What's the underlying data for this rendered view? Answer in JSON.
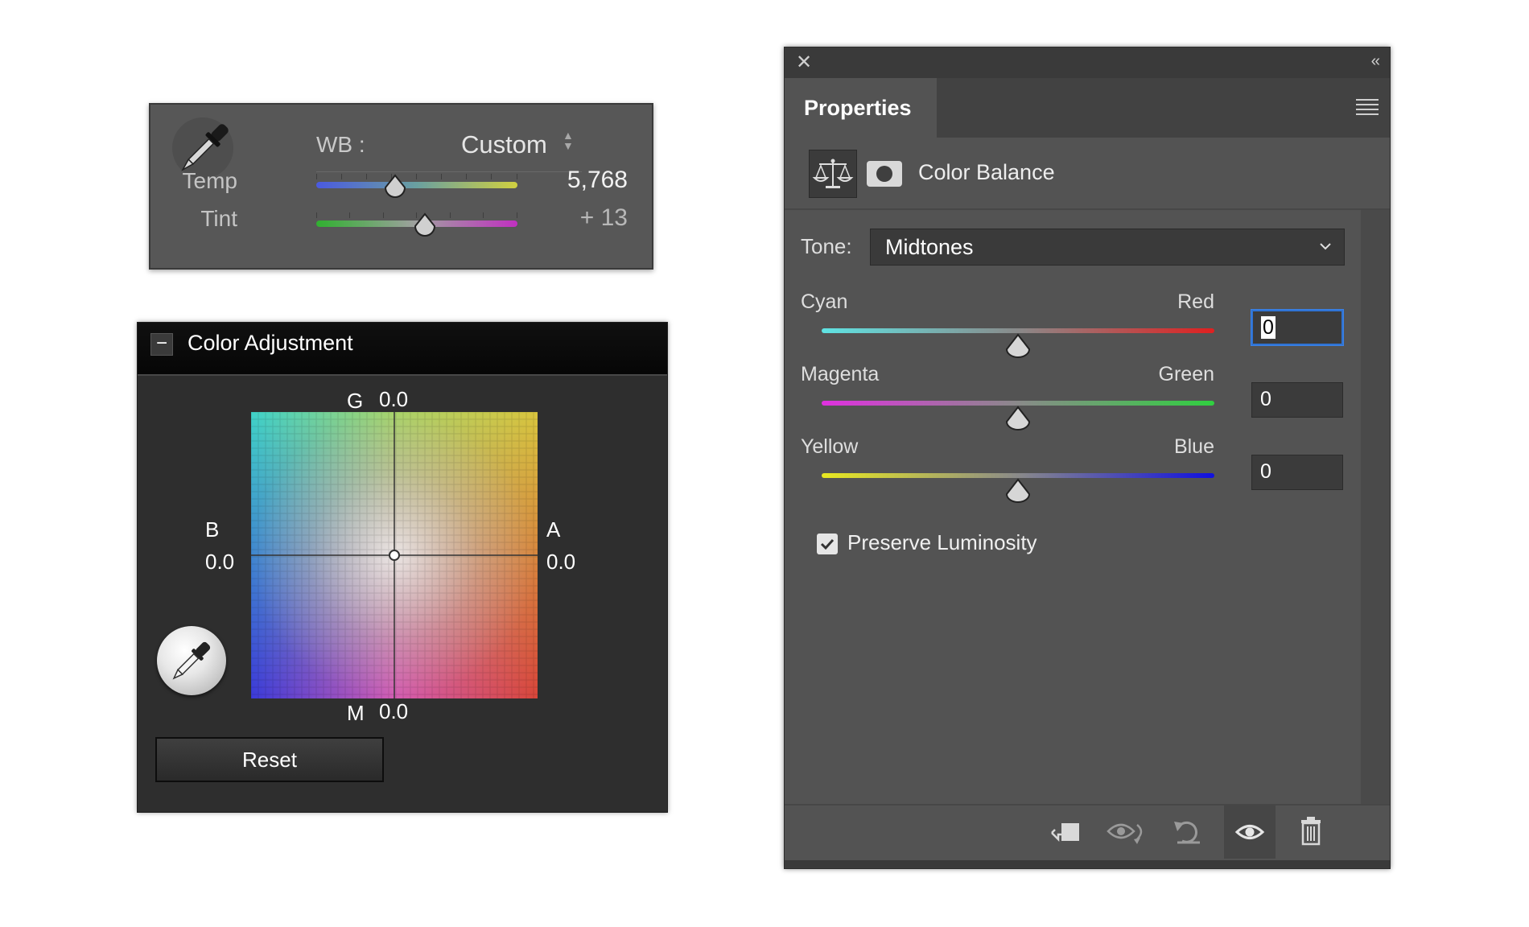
{
  "wb_panel": {
    "wb_label": "WB :",
    "wb_value": "Custom",
    "temp_label": "Temp",
    "temp_value": "5,768",
    "temp_position": 0.39,
    "tint_label": "Tint",
    "tint_value": "+ 13",
    "tint_position": 0.54,
    "icons": {
      "dropper": "eyedropper-icon",
      "updown": "updown-arrows-icon"
    }
  },
  "color_adjustment": {
    "title": "Color Adjustment",
    "collapse_symbol": "−",
    "g_label": "G",
    "g_value": "0.0",
    "m_label": "M",
    "m_value": "0.0",
    "b_label": "B",
    "b_value": "0.0",
    "a_label": "A",
    "a_value": "0.0",
    "reset_label": "Reset",
    "icons": {
      "picker": "eyedropper-icon"
    }
  },
  "properties": {
    "close_symbol": "✕",
    "collapse_symbol": "‹‹",
    "tab_label": "Properties",
    "heading": "Color Balance",
    "tone_label": "Tone:",
    "tone_value": "Midtones",
    "sliders": [
      {
        "left": "Cyan",
        "right": "Red",
        "value": "0",
        "position": 0.5,
        "colors": [
          "#5fe3e3",
          "#e02020"
        ]
      },
      {
        "left": "Magenta",
        "right": "Green",
        "value": "0",
        "position": 0.5,
        "colors": [
          "#e030e0",
          "#30d040"
        ]
      },
      {
        "left": "Yellow",
        "right": "Blue",
        "value": "0",
        "position": 0.5,
        "colors": [
          "#e8e820",
          "#1010e0"
        ]
      }
    ],
    "preserve_luminosity_label": "Preserve Luminosity",
    "preserve_luminosity_checked": true,
    "footer_icons": [
      "clip-to-layer-icon",
      "view-previous-state-icon",
      "reset-icon",
      "visibility-eye-icon",
      "trash-icon"
    ]
  }
}
